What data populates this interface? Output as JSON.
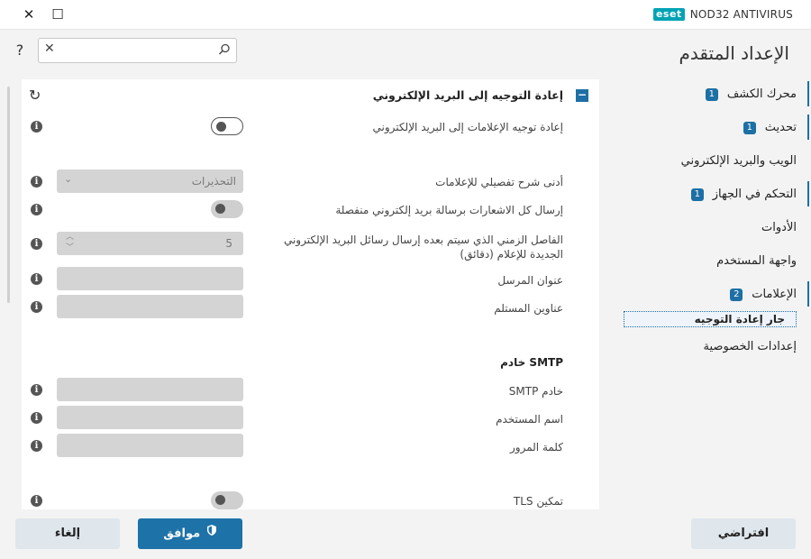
{
  "window": {
    "close_glyph": "✕",
    "maximize_glyph": "☐",
    "brand_logo": "eset",
    "product_name": "NOD32 ANTIVIRUS"
  },
  "header": {
    "title": "الإعداد المتقدم",
    "help_glyph": "?",
    "search": {
      "value": "",
      "placeholder": ""
    }
  },
  "sidebar": {
    "items": [
      {
        "label": "محرك الكشف",
        "badge": "1"
      },
      {
        "label": "تحديث",
        "badge": "1"
      },
      {
        "label": "الويب والبريد الإلكتروني",
        "badge": ""
      },
      {
        "label": "التحكم في الجهاز",
        "badge": "1"
      },
      {
        "label": "الأدوات",
        "badge": ""
      },
      {
        "label": "واجهة المستخدم",
        "badge": ""
      },
      {
        "label": "الإعلامات",
        "badge": "2"
      },
      {
        "label": "إعدادات الخصوصية",
        "badge": ""
      }
    ],
    "selected_sub": "جار إعادة التوجيه"
  },
  "panel": {
    "section_title": "إعادة التوجيه إلى البريد الإلكتروني",
    "collapse_glyph": "−",
    "revert_glyph": "↻",
    "rows": {
      "forward_email": "إعادة توجيه الإعلامات إلى البريد الإلكتروني",
      "min_verbosity": "أدنى شرح تفصيلي للإعلامات",
      "min_verbosity_value": "التحذيرات",
      "send_separate": "إرسال كل الاشعارات برسالة بريد إلكتروني منفصلة",
      "interval": "الفاصل الزمني الذي سيتم بعده إرسال رسائل البريد الإلكتروني الجديدة للإعلام (دقائق)",
      "interval_value": "5",
      "sender": "عنوان المرسل",
      "recipients": "عناوين المستلم",
      "smtp_heading": "خادم SMTP",
      "smtp_server": "خادم SMTP",
      "username": "اسم المستخدم",
      "password": "كلمة المرور",
      "tls": "تمكين TLS"
    },
    "info_glyph": "i"
  },
  "footer": {
    "default_label": "افتراضي",
    "ok_label": "موافق",
    "cancel_label": "إلغاء"
  },
  "colors": {
    "accent": "#1d6fa5",
    "eset_teal": "#00a3b4",
    "field_disabled": "#d4d4d4",
    "background": "#f3f3f3"
  }
}
